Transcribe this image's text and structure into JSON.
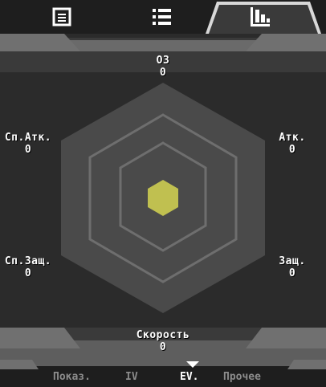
{
  "tabs": [
    {
      "name": "info-icon"
    },
    {
      "name": "list-icon"
    },
    {
      "name": "stats-chart-icon",
      "active": true
    }
  ],
  "stats": {
    "hp": {
      "label": "ОЗ",
      "value": "0"
    },
    "atk": {
      "label": "Атк.",
      "value": "0"
    },
    "def": {
      "label": "Защ.",
      "value": "0"
    },
    "speed": {
      "label": "Скорость",
      "value": "0"
    },
    "spdef": {
      "label": "Сп.Защ.",
      "value": "0"
    },
    "spatk": {
      "label": "Сп.Атк.",
      "value": "0"
    }
  },
  "bottom": {
    "items": [
      "Показ.",
      "IV",
      "EV.",
      "Прочее"
    ],
    "selected": "EV."
  },
  "colors": {
    "hex_outer": "#4a4a4a",
    "hex_ring": "#6e6e6e",
    "hex_fill": "#c0c050",
    "panel": "#585858"
  }
}
